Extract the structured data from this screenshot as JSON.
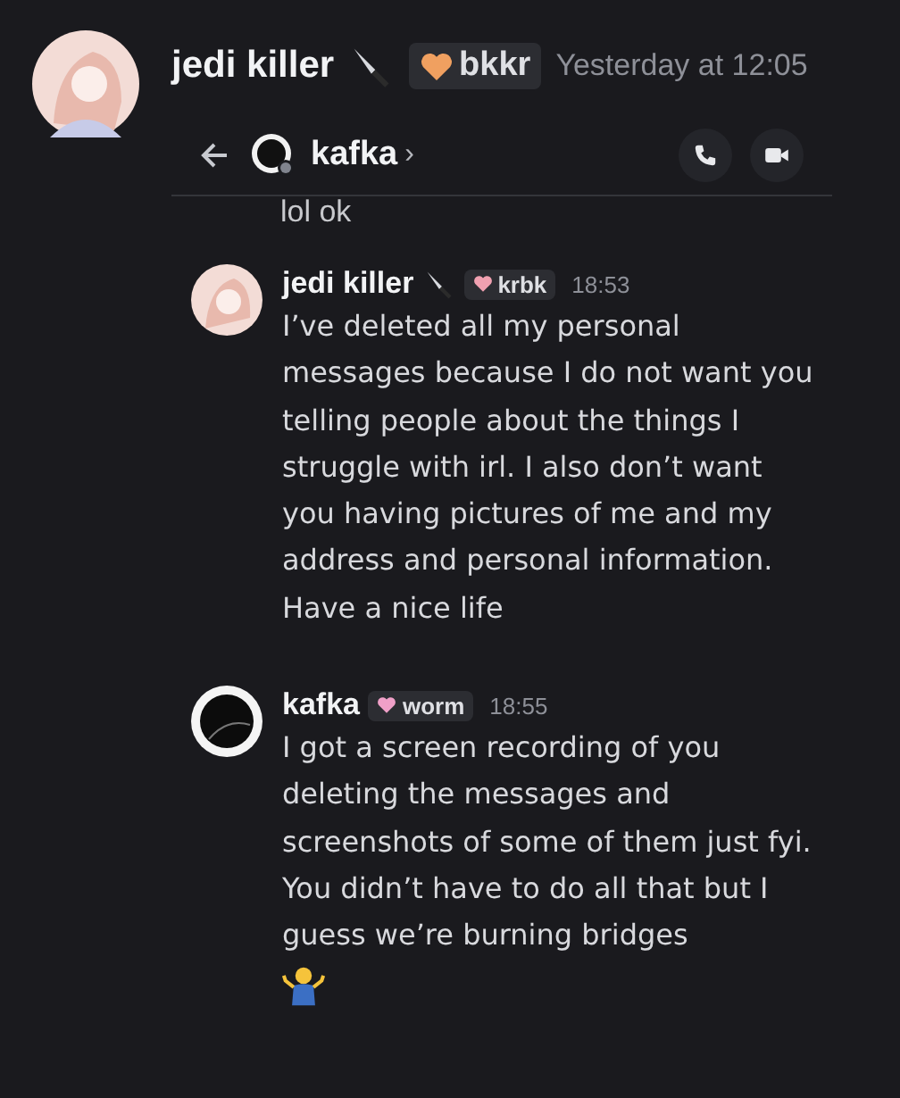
{
  "post": {
    "author": "jedi killer",
    "tag": {
      "label": "bkkr",
      "color": "#f0a060"
    },
    "time": "Yesterday at 12:05"
  },
  "screenshot": {
    "header": {
      "name": "kafka",
      "chevron": "›"
    },
    "cut_message": "lol ok",
    "messages": [
      {
        "author": "jedi killer",
        "knife": true,
        "tag": {
          "label": "krbk",
          "color": "#f0a0b0"
        },
        "time": "18:53",
        "text": "I’ve deleted all my personal messages because I do not want you telling people about the things I struggle with irl. I also don’t want you having pictures of me and my address and personal information. Have a nice life",
        "kind": "light",
        "shrug": false
      },
      {
        "author": "kafka",
        "knife": false,
        "tag": {
          "label": "worm",
          "color": "#f0a0c8"
        },
        "time": "18:55",
        "text": "I got a screen recording of you deleting the messages and screenshots of some of them just fyi. You didn’t have to do all that but I guess we’re burning bridges",
        "kind": "dark",
        "shrug": true
      }
    ]
  }
}
